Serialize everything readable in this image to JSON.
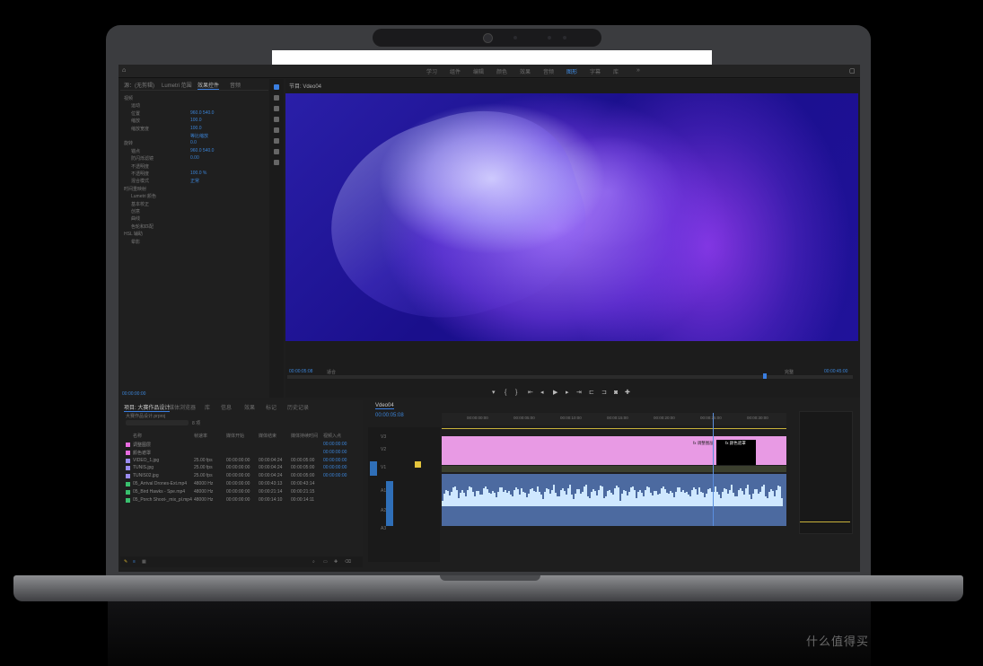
{
  "workspace_tabs": [
    "学习",
    "组件",
    "编辑",
    "颜色",
    "效果",
    "音频",
    "图形",
    "字幕",
    "库"
  ],
  "active_workspace_index": 6,
  "effect_controls": {
    "tabs": [
      "源：(无剪辑)",
      "Lumetri 范围",
      "效果控件",
      "音频"
    ],
    "rows": [
      {
        "label": "视频",
        "value": ""
      },
      {
        "label": "运动",
        "value": ""
      },
      {
        "label": "位置",
        "value": "960.0   540.0"
      },
      {
        "label": "缩放",
        "value": "100.0"
      },
      {
        "label": "缩放宽度",
        "value": "100.0"
      },
      {
        "label": "",
        "value": "等比缩放"
      },
      {
        "label": "旋转",
        "value": "0.0"
      },
      {
        "label": "锚点",
        "value": "960.0   540.0"
      },
      {
        "label": "防闪烁滤镜",
        "value": "0.00"
      },
      {
        "label": "不透明度",
        "value": ""
      },
      {
        "label": "不透明度",
        "value": "100.0 %"
      },
      {
        "label": "混合模式",
        "value": "正常"
      },
      {
        "label": "时间重映射",
        "value": ""
      },
      {
        "label": "Lumetri 颜色",
        "value": ""
      },
      {
        "label": "基本校正",
        "value": ""
      },
      {
        "label": "创意",
        "value": ""
      },
      {
        "label": "曲线",
        "value": ""
      },
      {
        "label": "色轮和匹配",
        "value": ""
      },
      {
        "label": "HSL 辅助",
        "value": ""
      },
      {
        "label": "晕影",
        "value": ""
      }
    ],
    "timecode": "00:00:00:00"
  },
  "program_monitor": {
    "title": "节目: Vdeo04",
    "timecode_left": "00:00:05:08",
    "fit": "适合",
    "quality": "完整",
    "timecode_right": "00:00:45:00"
  },
  "project_panel": {
    "tabs": [
      "项目: 大赛作品设计",
      "媒体浏览器",
      "库",
      "信息",
      "效果",
      "标记",
      "历史记录"
    ],
    "search_placeholder": "",
    "path": "大赛作品设计.prproj",
    "item_count": "8 项",
    "columns": [
      "名称",
      "帧速率",
      "媒体开始",
      "媒体结束",
      "媒体持续时间",
      "视频入点"
    ],
    "items": [
      {
        "name": "调整图层",
        "fps": "",
        "start": "",
        "end": "",
        "duration": "",
        "in": "00:00:00:00",
        "color": "#e86ce0"
      },
      {
        "name": "颜色遮罩",
        "fps": "",
        "start": "",
        "end": "",
        "duration": "",
        "in": "00:00:00:00",
        "color": "#e86ce0"
      },
      {
        "name": "VIDEO_1.jpg",
        "fps": "25.00 fps",
        "start": "00:00:00:00",
        "end": "00:00:04:24",
        "duration": "00:00:05:00",
        "in": "00:00:00:00",
        "color": "#9b8cf0"
      },
      {
        "name": "TUNIS.jpg",
        "fps": "25.00 fps",
        "start": "00:00:00:00",
        "end": "00:00:04:24",
        "duration": "00:00:05:00",
        "in": "00:00:00:00",
        "color": "#9b8cf0"
      },
      {
        "name": "TUNIS02.jpg",
        "fps": "25.00 fps",
        "start": "00:00:00:00",
        "end": "00:00:04:24",
        "duration": "00:00:05:00",
        "in": "00:00:00:00",
        "color": "#9b8cf0"
      },
      {
        "name": "05_Arrival Drones-Ext.mp4",
        "fps": "48000 Hz",
        "start": "00:00:00:00",
        "end": "00:00:43:13",
        "duration": "00:00:43:14",
        "in": "",
        "color": "#39c06e"
      },
      {
        "name": "05_Bird Hawks - Spe.mp4",
        "fps": "48000 Hz",
        "start": "00:00:00:00",
        "end": "00:00:21:14",
        "duration": "00:00:21:15",
        "in": "",
        "color": "#39c06e"
      },
      {
        "name": "05_Porch Shoot-_mix_pl.mp4",
        "fps": "48000 Hz",
        "start": "00:00:00:00",
        "end": "00:00:14:10",
        "duration": "00:00:14:11",
        "in": "",
        "color": "#39c06e"
      }
    ]
  },
  "timeline": {
    "title": "Vdeo04",
    "timecode": "00:00:05:08",
    "ruler_ticks": [
      "00:00:00:00",
      "00:00:05:00",
      "00:00:10:00",
      "00:00:15:00",
      "00:00:20:00",
      "00:00:25:00",
      "00:00:30:00"
    ],
    "tracks": [
      "V3",
      "V2",
      "V1",
      "A1",
      "A2",
      "A3"
    ],
    "clip_tags": [
      "fx 调整图层",
      "fx 颜色遮罩"
    ]
  },
  "colors": {
    "accent": "#3b83d6",
    "clip_video": "#e89ae4",
    "clip_audio": "#4c6aa0",
    "waveform": "#cfe8ff"
  },
  "watermark": "什么值得买"
}
